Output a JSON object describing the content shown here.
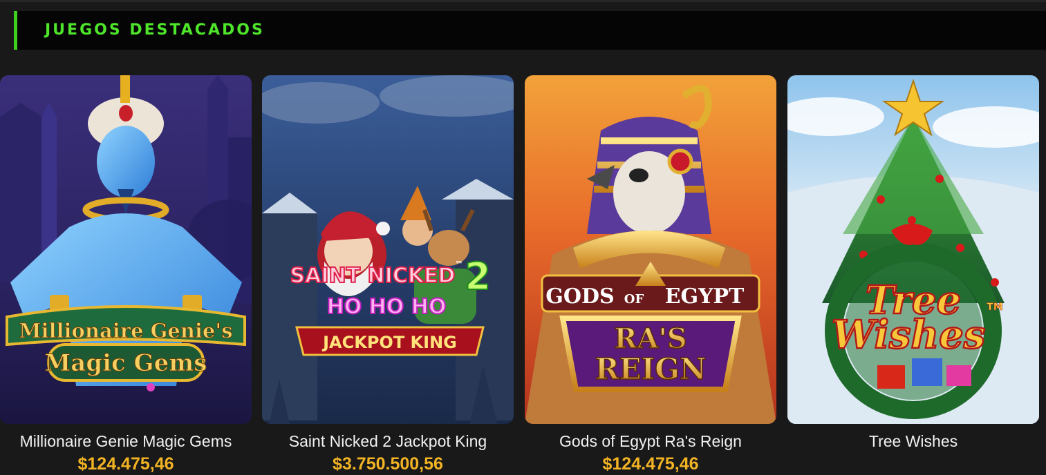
{
  "section": {
    "title": "JUEGOS DESTACADOS",
    "accent_color": "#3fd11e"
  },
  "games": [
    {
      "title": "Millionaire Genie Magic Gems",
      "jackpot": "$124.475,46",
      "logo_line1": "Millionaire Genie's",
      "logo_line2": "Magic Gems"
    },
    {
      "title": "Saint Nicked 2 Jackpot King",
      "jackpot": "$3.750.500,56",
      "logo_line1": "SAINT NICKED",
      "logo_num": "2",
      "logo_tm": "™",
      "logo_line2": "HO HO HO",
      "logo_line3": "JACKPOT KING"
    },
    {
      "title": "Gods of Egypt Ra's Reign",
      "jackpot": "$124.475,46",
      "logo_line1a": "GODS",
      "logo_of": "OF",
      "logo_line1b": "EGYPT",
      "logo_line2": "RA'S",
      "logo_line3": "REIGN"
    },
    {
      "title": "Tree Wishes",
      "jackpot": "",
      "logo_line1": "Tree",
      "logo_line2": "Wishes",
      "logo_tm": "TM"
    }
  ],
  "colors": {
    "title_text": "#f2f2f2",
    "jackpot_text": "#f2b324",
    "background": "#191919"
  }
}
